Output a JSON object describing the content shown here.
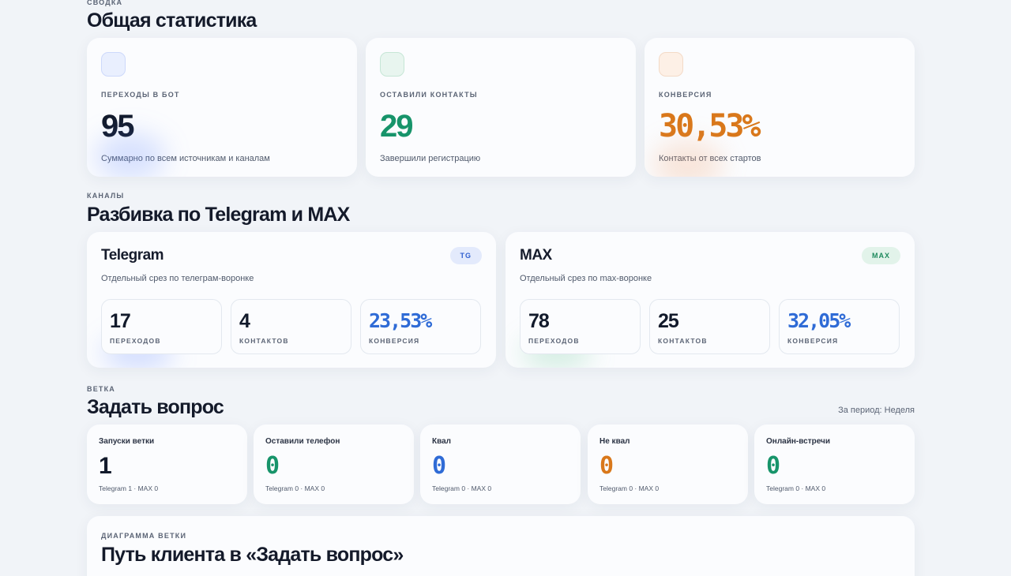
{
  "summary": {
    "eyebrow": "СВОДКА",
    "title": "Общая статистика",
    "cards": [
      {
        "label": "ПЕРЕХОДЫ В БОТ",
        "value": "95",
        "desc": "Суммарно по всем источникам и каналам",
        "color": "#121a2b"
      },
      {
        "label": "ОСТАВИЛИ КОНТАКТЫ",
        "value": "29",
        "desc": "Завершили регистрацию",
        "color": "#17946a"
      },
      {
        "label": "КОНВЕРСИЯ",
        "value": "30,53%",
        "desc": "Контакты от всех стартов",
        "color": "#d9781b"
      }
    ]
  },
  "channels": {
    "eyebrow": "КАНАЛЫ",
    "title": "Разбивка по Telegram и MAX",
    "items": [
      {
        "name": "Telegram",
        "badge": "TG",
        "desc": "Отдельный срез по телеграм-воронке",
        "metrics": [
          {
            "value": "17",
            "label": "ПЕРЕХОДОВ"
          },
          {
            "value": "4",
            "label": "КОНТАКТОВ"
          },
          {
            "value": "23,53%",
            "label": "КОНВЕРСИЯ"
          }
        ]
      },
      {
        "name": "MAX",
        "badge": "MAX",
        "desc": "Отдельный срез по max-воронке",
        "metrics": [
          {
            "value": "78",
            "label": "ПЕРЕХОДОВ"
          },
          {
            "value": "25",
            "label": "КОНТАКТОВ"
          },
          {
            "value": "32,05%",
            "label": "КОНВЕРСИЯ"
          }
        ]
      }
    ]
  },
  "branch": {
    "eyebrow": "ВЕТКА",
    "title": "Задать вопрос",
    "period": "За период: Неделя",
    "cards": [
      {
        "title": "Запуски ветки",
        "value": "1",
        "sub": "Telegram 1 · MAX 0",
        "color": "#121a2b"
      },
      {
        "title": "Оставили телефон",
        "value": "0",
        "sub": "Telegram 0 · MAX 0",
        "color": "#17946a"
      },
      {
        "title": "Квал",
        "value": "0",
        "sub": "Telegram 0 · MAX 0",
        "color": "#2f6bd6"
      },
      {
        "title": "Не квал",
        "value": "0",
        "sub": "Telegram 0 · MAX 0",
        "color": "#d9781b"
      },
      {
        "title": "Онлайн-встречи",
        "value": "0",
        "sub": "Telegram 0 · MAX 0",
        "color": "#17946a"
      }
    ]
  },
  "diagram": {
    "eyebrow": "ДИАГРАММА ВЕТКИ",
    "title": "Путь клиента в «Задать вопрос»"
  }
}
